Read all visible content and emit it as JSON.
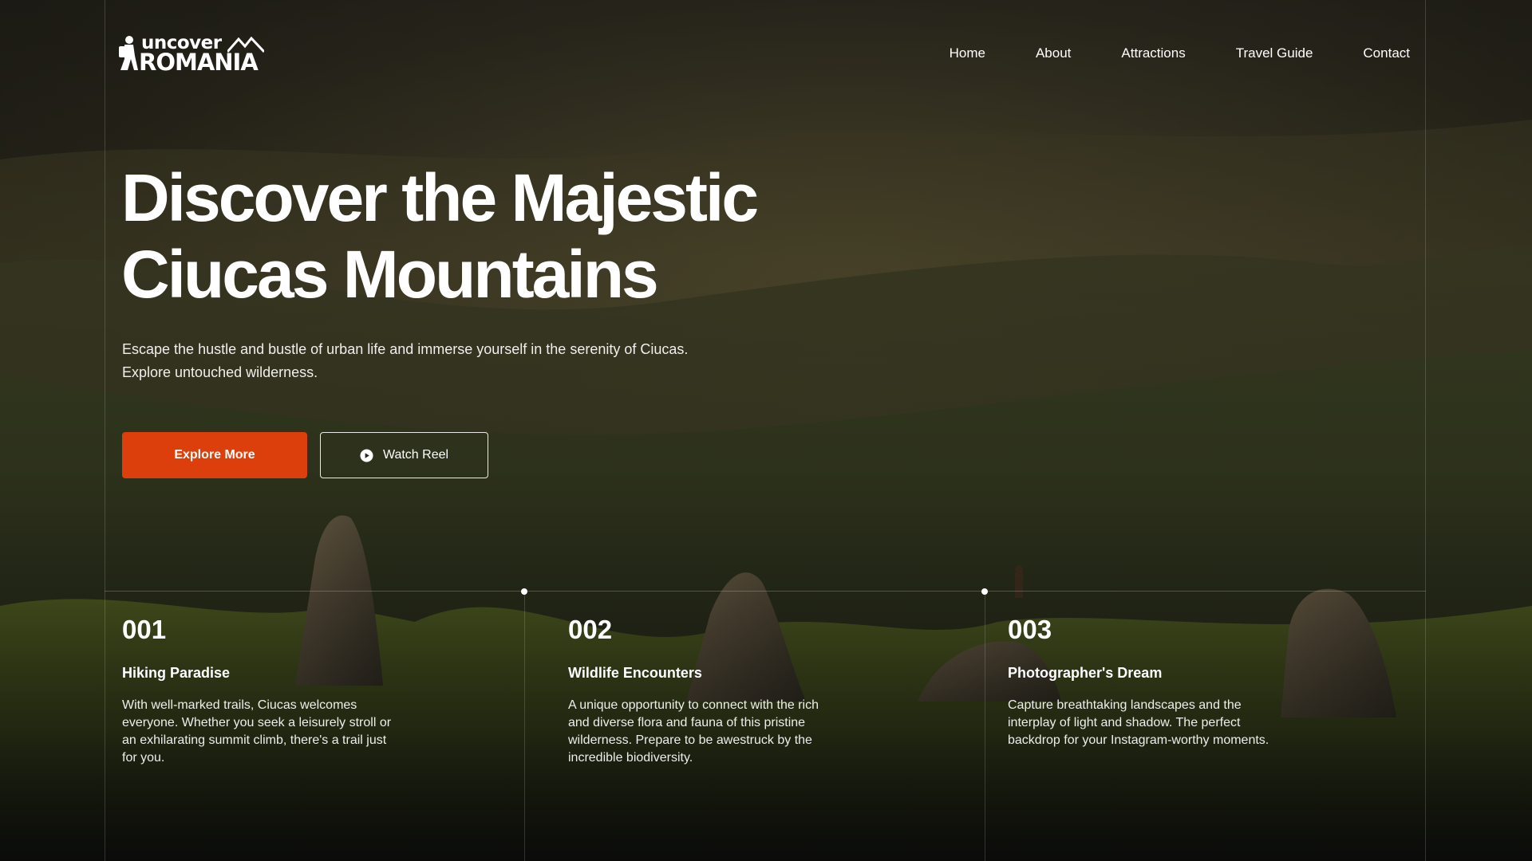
{
  "brand": {
    "logo_top": "uncover",
    "logo_bottom": "ROMANIA"
  },
  "nav": {
    "items": [
      {
        "label": "Home"
      },
      {
        "label": "About"
      },
      {
        "label": "Attractions"
      },
      {
        "label": "Travel Guide"
      },
      {
        "label": "Contact"
      }
    ]
  },
  "hero": {
    "headline_line1": "Discover the Majestic",
    "headline_line2": "Ciucas Mountains",
    "subtext": "Escape the hustle and bustle of urban life and immerse yourself in the serenity of Ciucas. Explore untouched wilderness.",
    "primary_button": "Explore More",
    "secondary_button": "Watch Reel"
  },
  "features": [
    {
      "number": "001",
      "title": "Hiking Paradise",
      "description": "With well-marked trails, Ciucas welcomes everyone. Whether you seek a leisurely stroll or an exhilarating summit climb, there's a trail just for you."
    },
    {
      "number": "002",
      "title": "Wildlife Encounters",
      "description": "A unique opportunity to connect with the rich and diverse flora and fauna of this pristine wilderness. Prepare to be awestruck by the incredible biodiversity."
    },
    {
      "number": "003",
      "title": "Photographer's Dream",
      "description": "Capture breathtaking landscapes and the interplay of light and shadow. The perfect backdrop for your Instagram-worthy moments."
    }
  ],
  "colors": {
    "accent": "#dc3f0b",
    "text": "#ffffff"
  },
  "icons": {
    "logo_mark": "hiker-mountain-icon",
    "watch_reel": "play-circle-icon"
  }
}
